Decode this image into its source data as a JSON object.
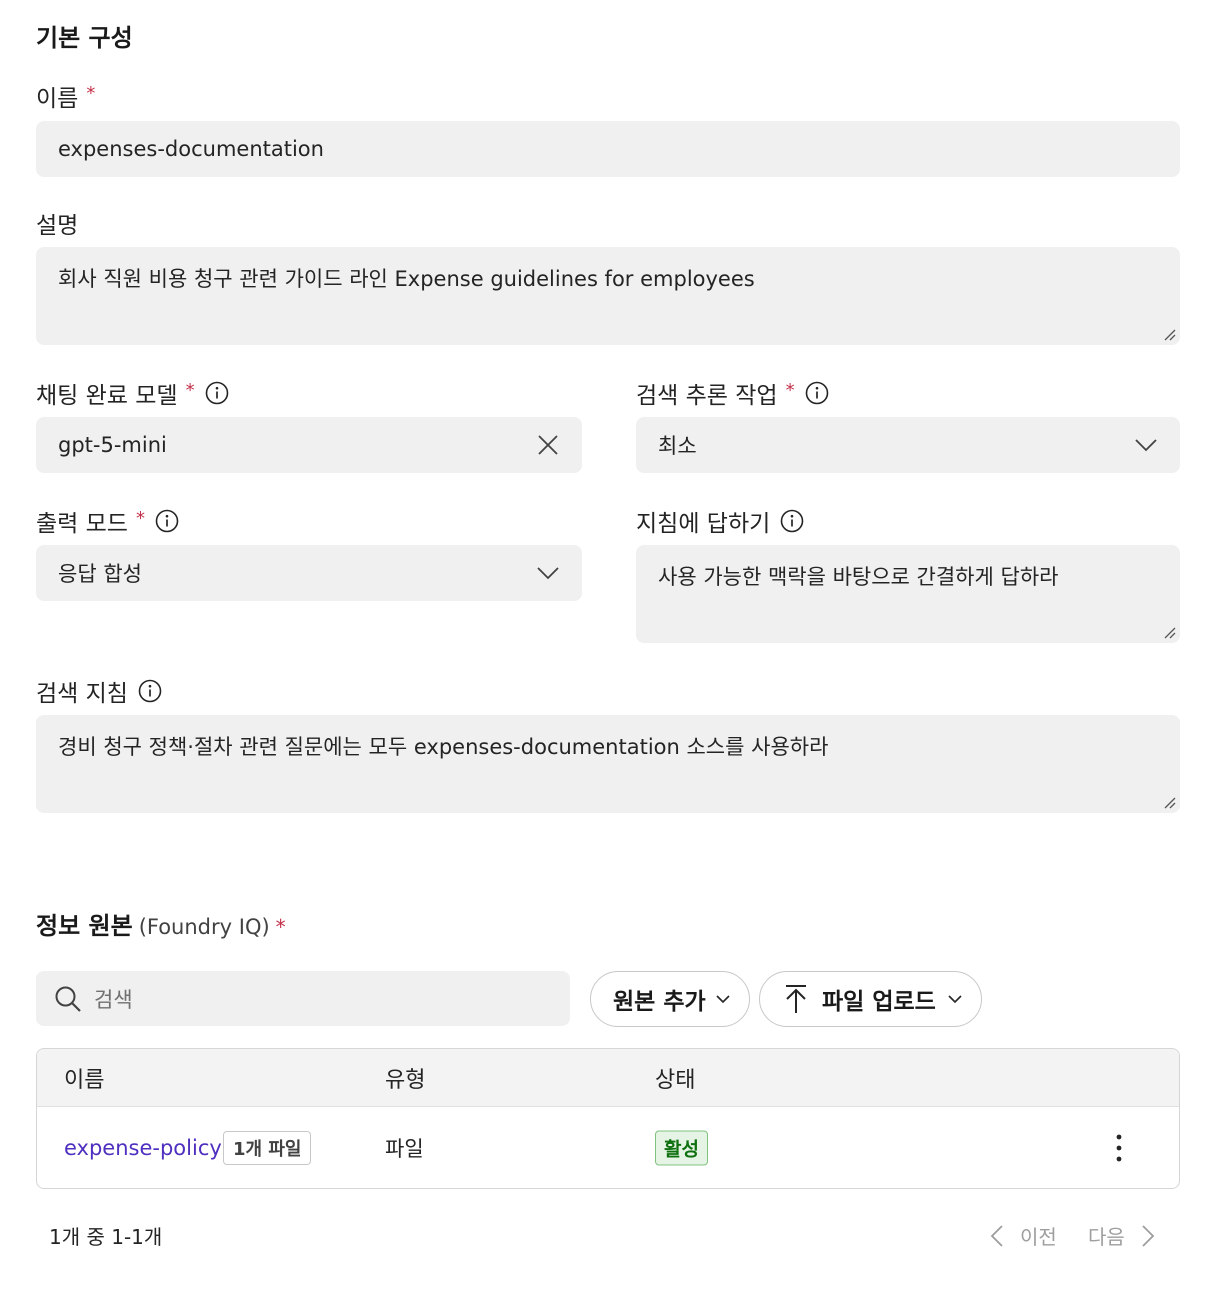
{
  "section_basic": {
    "title": "기본 구성"
  },
  "name_field": {
    "label": "이름",
    "required_mark": "*",
    "value": "expenses-documentation"
  },
  "description_field": {
    "label": "설명",
    "value": "회사 직원 비용 청구 관련 가이드 라인 Expense guidelines for employees"
  },
  "model_field": {
    "label": "채팅 완료 모델",
    "required_mark": "*",
    "value": "gpt-5-mini",
    "icon": "close-icon"
  },
  "reasoning_field": {
    "label": "검색 추론 작업",
    "required_mark": "*",
    "value": "최소",
    "icon": "chevron-down-icon"
  },
  "output_mode_field": {
    "label": "출력 모드",
    "required_mark": "*",
    "value": "응답 합성",
    "icon": "chevron-down-icon"
  },
  "answer_instructions_field": {
    "label": "지침에 답하기",
    "value": "사용 가능한 맥락을 바탕으로 간결하게 답하라"
  },
  "retrieval_instructions_field": {
    "label": "검색 지침",
    "value": "경비 청구 정책·절차 관련 질문에는 모두 expenses-documentation 소스를 사용하라"
  },
  "sources_section": {
    "title": "정보 원본",
    "subtitle": "(Foundry IQ)",
    "required_mark": "*"
  },
  "search": {
    "placeholder": "검색"
  },
  "toolbar": {
    "add_source_label": "원본 추가",
    "upload_label": "파일 업로드"
  },
  "table": {
    "columns": {
      "name": "이름",
      "type": "유형",
      "status": "상태"
    },
    "rows": [
      {
        "name": "expense-policy",
        "badge": "1개 파일",
        "type": "파일",
        "status": "활성"
      }
    ]
  },
  "pagination": {
    "summary": "1개 중 1-1개",
    "prev_label": "이전",
    "next_label": "다음"
  },
  "colors": {
    "required": "#c4314b",
    "link": "#4f2fbf",
    "status_active": "#0e700e",
    "field_bg": "#f0f0f0"
  }
}
